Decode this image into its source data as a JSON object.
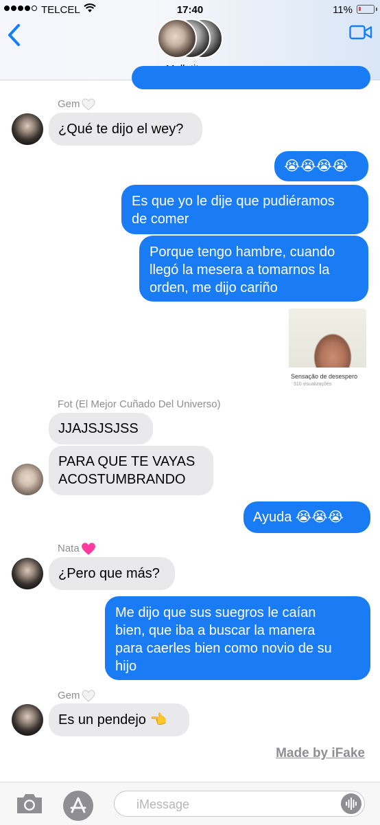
{
  "status_bar": {
    "carrier": "TELCEL",
    "time": "17:40",
    "battery": "11%"
  },
  "header": {
    "group_name": "Molletitos",
    "chevron": "›"
  },
  "messages": [
    {
      "dir": "in",
      "sender": "Gem",
      "sender_heart": "white",
      "text": "¿Qué te dijo el wey?"
    },
    {
      "dir": "out",
      "text": "😭😭😭😭"
    },
    {
      "dir": "out",
      "line1": "Es que yo le dije que pudiéramos",
      "line2": "de comer"
    },
    {
      "dir": "out",
      "line1": "Porque tengo hambre, cuando",
      "line2": "llegó la mesera a tomarnos la",
      "line3": "orden, me dijo cariño"
    },
    {
      "dir": "out",
      "type": "media",
      "title": "Sensação de desespero",
      "views": "310 visualizações"
    },
    {
      "dir": "in",
      "sender": "Fot (El Mejor Cuñado Del Universo)",
      "text": "JJAJSJSJSS"
    },
    {
      "dir": "in",
      "line1": "PARA QUE TE VAYAS",
      "line2": "ACOSTUMBRANDO"
    },
    {
      "dir": "out",
      "text": "Ayuda 😭😭😭"
    },
    {
      "dir": "in",
      "sender": "Nata",
      "sender_heart": "pink",
      "text": "¿Pero que más?"
    },
    {
      "dir": "out",
      "line1": "Me dijo que sus suegros le caían",
      "line2": "bien, que iba a buscar la manera",
      "line3": "para caerles bien como novio de su",
      "line4": "hijo"
    },
    {
      "dir": "in",
      "sender": "Gem",
      "sender_heart": "white",
      "text": "Es un pendejo 👈"
    }
  ],
  "watermark": "Made by iFake",
  "composer": {
    "placeholder": "iMessage"
  },
  "icons": [
    "back-chevron-icon",
    "video-camera-icon",
    "camera-icon",
    "app-store-icon",
    "audio-waveform-icon",
    "wifi-icon",
    "battery-icon",
    "heart-icon"
  ],
  "colors": {
    "outgoing": "#1a7cf5",
    "incoming": "#e9e9eb",
    "accent": "#147efb",
    "battery_low": "#ff3b30",
    "heart_pink": "#ff3c9e"
  }
}
